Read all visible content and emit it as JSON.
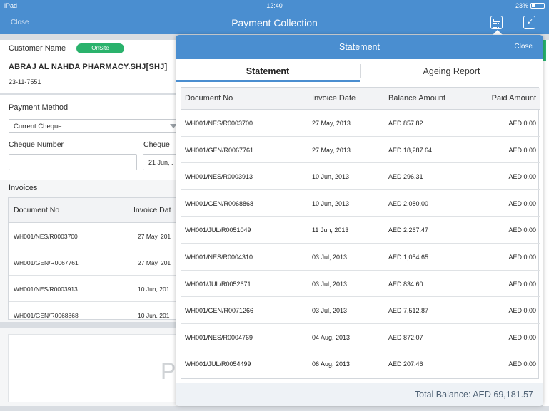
{
  "status_bar": {
    "device": "iPad",
    "time": "12:40",
    "battery": "23%"
  },
  "navbar": {
    "close_label": "Close",
    "title": "Payment Collection"
  },
  "customer": {
    "label": "Customer Name",
    "badge": "OnSite",
    "name": "ABRAJ AL NAHDA PHARMACY.SHJ[SHJ]",
    "date": "23-11-7551"
  },
  "payment": {
    "method_label": "Payment Method",
    "method_value": "Current Cheque",
    "cheque_number_label": "Cheque Number",
    "cheque_date_label": "Cheque",
    "cheque_number_value": "",
    "cheque_date_value": "21 Jun, ."
  },
  "invoices": {
    "label": "Invoices",
    "headers": [
      "Document No",
      "Invoice Dat"
    ],
    "rows": [
      [
        "WH001/NES/R0003700",
        "27 May, 201"
      ],
      [
        "WH001/GEN/R0067761",
        "27 May, 201"
      ],
      [
        "WH001/NES/R0003913",
        "10 Jun, 201"
      ],
      [
        "WH001/GEN/R0068868",
        "10 Jun, 201"
      ]
    ]
  },
  "signature_placeholder": "P",
  "statement": {
    "title": "Statement",
    "close_label": "Close",
    "tabs": [
      "Statement",
      "Ageing Report"
    ],
    "headers": [
      "Document No",
      "Invoice Date",
      "Balance Amount",
      "Paid Amount"
    ],
    "rows": [
      [
        "WH001/NES/R0003700",
        "27 May, 2013",
        "AED 857.82",
        "AED 0.00"
      ],
      [
        "WH001/GEN/R0067761",
        "27 May, 2013",
        "AED 18,287.64",
        "AED 0.00"
      ],
      [
        "WH001/NES/R0003913",
        "10 Jun, 2013",
        "AED 296.31",
        "AED 0.00"
      ],
      [
        "WH001/GEN/R0068868",
        "10 Jun, 2013",
        "AED 2,080.00",
        "AED 0.00"
      ],
      [
        "WH001/JUL/R0051049",
        "11 Jun, 2013",
        "AED 2,267.47",
        "AED 0.00"
      ],
      [
        "WH001/NES/R0004310",
        "03 Jul, 2013",
        "AED 1,054.65",
        "AED 0.00"
      ],
      [
        "WH001/JUL/R0052671",
        "03 Jul, 2013",
        "AED 834.60",
        "AED 0.00"
      ],
      [
        "WH001/GEN/R0071266",
        "03 Jul, 2013",
        "AED 7,512.87",
        "AED 0.00"
      ],
      [
        "WH001/NES/R0004769",
        "04 Aug, 2013",
        "AED 872.07",
        "AED 0.00"
      ],
      [
        "WH001/JUL/R0054499",
        "06 Aug, 2013",
        "AED 207.46",
        "AED 0.00"
      ]
    ],
    "total": "Total Balance: AED 69,181.57"
  },
  "icons": [
    "calculator-icon",
    "checkmark-doc-icon",
    "dropdown-arrow-icon",
    "wifi-icon",
    "battery-icon"
  ],
  "colors": {
    "primary": "#4a8ed0",
    "badge": "#2ab26c"
  }
}
